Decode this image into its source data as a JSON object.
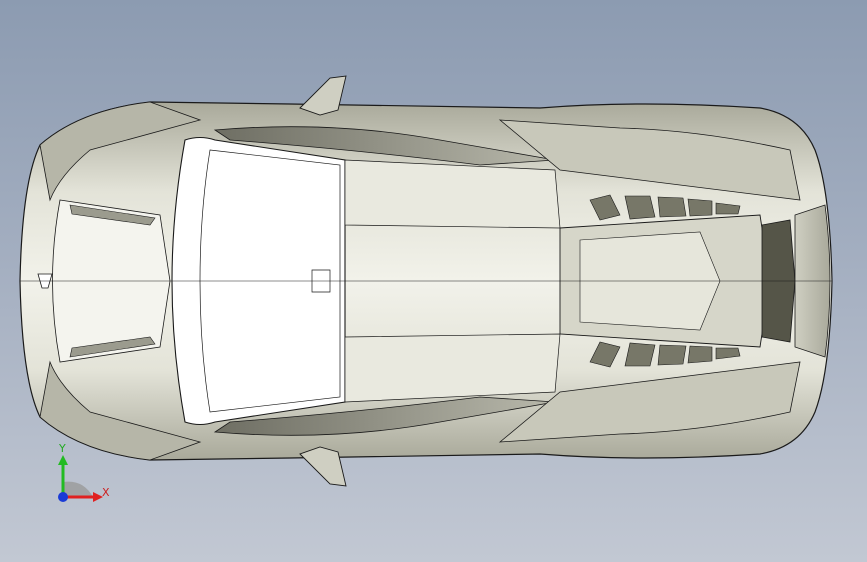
{
  "triad": {
    "x_label": "X",
    "y_label": "Y",
    "x_color": "#e02020",
    "y_color": "#22bb22",
    "z_color": "#1a3bd6",
    "plane_color": "#9a9a9a"
  },
  "viewport": {
    "background_top": "#8c9bb1",
    "background_bottom": "#c2c8d3"
  },
  "model": {
    "name": "sports-car-top-view",
    "body_color": "#dcdccf",
    "window_color": "#ffffff",
    "edge_color": "#1a1a1a"
  }
}
